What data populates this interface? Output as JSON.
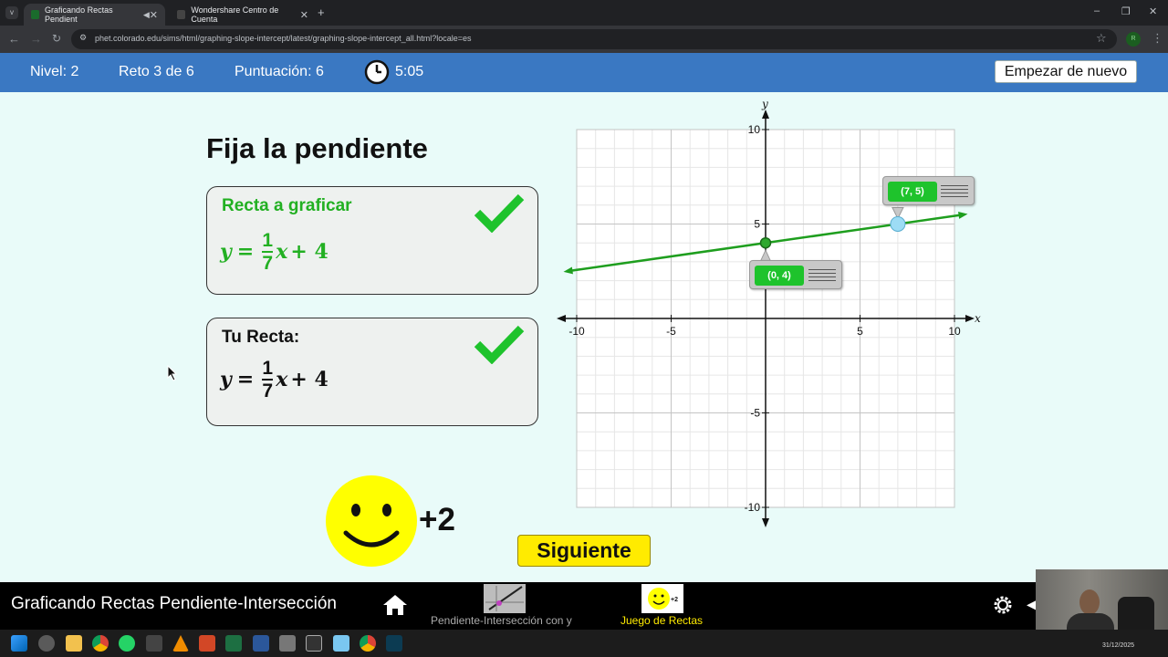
{
  "browser": {
    "tabs": [
      {
        "title": "Graficando Rectas Pendient",
        "active": true
      },
      {
        "title": "Wondershare Centro de Cuenta",
        "active": false
      }
    ],
    "url": "phet.colorado.edu/sims/html/graphing-slope-intercept/latest/graphing-slope-intercept_all.html?locale=es"
  },
  "topbar": {
    "level": "Nivel: 2",
    "challenge": "Reto 3 de 6",
    "score": "Puntuación: 6",
    "time": "5:05",
    "reset_label": "Empezar de nuevo"
  },
  "challenge": {
    "title": "Fija la pendiente",
    "target_box": {
      "label": "Recta a graficar",
      "y": "y",
      "eq": "=",
      "num": "1",
      "den": "7",
      "x": "x",
      "rest": "+ 4",
      "correct": true
    },
    "user_box": {
      "label": "Tu Recta:",
      "y": "y",
      "eq": "=",
      "num": "1",
      "den": "7",
      "x": "x",
      "rest": "+ 4",
      "correct": true
    },
    "points_earned": "+2",
    "next_label": "Siguiente"
  },
  "graph": {
    "x_axis_label": "x",
    "y_axis_label": "y",
    "xrange": [
      -10,
      10
    ],
    "yrange": [
      -10,
      10
    ],
    "x_tick_labels": [
      "-10",
      "-5",
      "5",
      "10"
    ],
    "y_tick_labels": [
      "10",
      "5",
      "-5",
      "-10"
    ],
    "line": {
      "slope": 0.142857,
      "intercept": 4,
      "color": "#1e9e1e"
    },
    "points": [
      {
        "label": "(0, 4)",
        "x": 0,
        "y": 4
      },
      {
        "label": "(7, 5)",
        "x": 7,
        "y": 5
      }
    ]
  },
  "navbar": {
    "sim_title": "Graficando Rectas Pendiente-Intersección",
    "screens": [
      {
        "label": "Pendiente-Intersección con y",
        "color": "#bdbdbd"
      },
      {
        "label": "Juego de Rectas",
        "color": "#ffeb00"
      }
    ]
  },
  "taskbar": {
    "date": "31/12/2025"
  },
  "colors": {
    "accent": "#3a78c2",
    "background": "#e9fbf9",
    "correct": "#1ec32c"
  }
}
